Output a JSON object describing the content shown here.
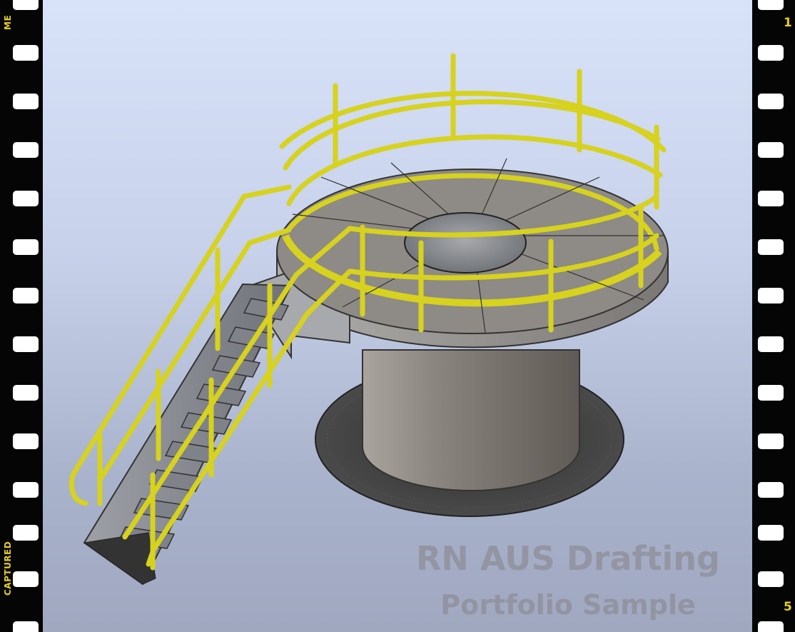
{
  "film_strip": {
    "left_top_text": "ME",
    "left_bottom_text": "CAPTURED",
    "right_top_number": "1",
    "right_bottom_number": "5"
  },
  "watermark": {
    "line1": "RN AUS Drafting",
    "line2": "Portfolio Sample"
  },
  "model": {
    "railing_color": "#d6d21e",
    "deck_color": "#8a8680",
    "tank_color": "#7e7872",
    "gravel_color": "#3c3c3c"
  }
}
